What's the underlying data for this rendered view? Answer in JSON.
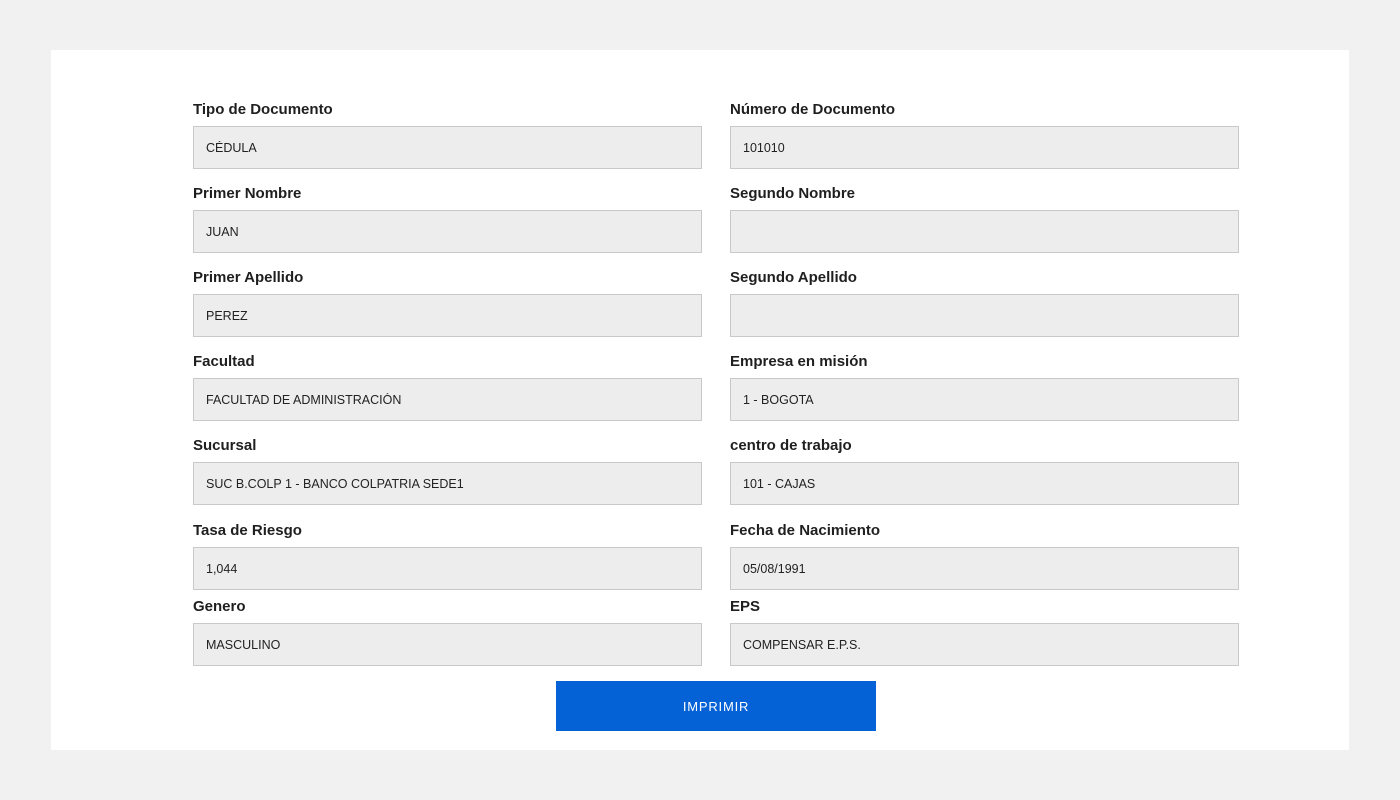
{
  "form": {
    "fields": [
      {
        "label": "Tipo de Documento",
        "value": "CÉDULA"
      },
      {
        "label": "Número de Documento",
        "value": "101010"
      },
      {
        "label": "Primer Nombre",
        "value": "JUAN"
      },
      {
        "label": "Segundo Nombre",
        "value": ""
      },
      {
        "label": "Primer Apellido",
        "value": "PEREZ"
      },
      {
        "label": "Segundo Apellido",
        "value": ""
      },
      {
        "label": "Facultad",
        "value": "FACULTAD DE ADMINISTRACIÓN"
      },
      {
        "label": "Empresa en misión",
        "value": "1 - BOGOTA"
      },
      {
        "label": "Sucursal",
        "value": "SUC B.COLP 1 - BANCO COLPATRIA SEDE1"
      },
      {
        "label": "centro de trabajo",
        "value": "101 - CAJAS"
      },
      {
        "label": "Tasa de Riesgo",
        "value": "1,044"
      },
      {
        "label": "Fecha de Nacimiento",
        "value": "05/08/1991"
      },
      {
        "label": "Genero",
        "value": "MASCULINO"
      },
      {
        "label": "EPS",
        "value": "COMPENSAR E.P.S."
      }
    ],
    "print_button": "IMPRIMIR"
  },
  "colors": {
    "page_background": "#f1f1f1",
    "card_background": "#ffffff",
    "input_background": "#ededed",
    "button": "#0461d6"
  }
}
